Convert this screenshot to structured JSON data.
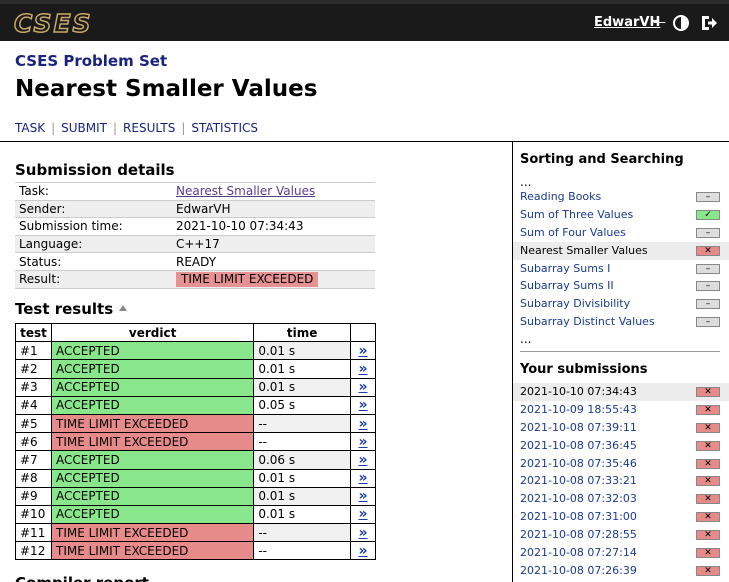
{
  "header": {
    "logo": "CSES",
    "username": "EdwarVH",
    "separator": "—",
    "theme_icon": "half-circle-icon",
    "logout_icon": "logout-icon"
  },
  "problem_set": "CSES Problem Set",
  "title": "Nearest Smaller Values",
  "tabs": [
    {
      "label": "TASK"
    },
    {
      "label": "SUBMIT"
    },
    {
      "label": "RESULTS"
    },
    {
      "label": "STATISTICS"
    }
  ],
  "submission": {
    "heading": "Submission details",
    "rows": [
      {
        "key": "Task:",
        "value": "Nearest Smaller Values"
      },
      {
        "key": "Sender:",
        "value": "EdwarVH"
      },
      {
        "key": "Submission time:",
        "value": "2021-10-10 07:34:43"
      },
      {
        "key": "Language:",
        "value": "C++17"
      },
      {
        "key": "Status:",
        "value": "READY"
      },
      {
        "key": "Result:",
        "value": "TIME LIMIT EXCEEDED"
      }
    ]
  },
  "tests": {
    "heading": "Test results",
    "columns": {
      "test": "test",
      "verdict": "verdict",
      "time": "time"
    },
    "link_glyph": "»",
    "rows": [
      {
        "test": "#1",
        "verdict": "ACCEPTED",
        "time": "0.01 s",
        "status": "ok"
      },
      {
        "test": "#2",
        "verdict": "ACCEPTED",
        "time": "0.01 s",
        "status": "ok"
      },
      {
        "test": "#3",
        "verdict": "ACCEPTED",
        "time": "0.01 s",
        "status": "ok"
      },
      {
        "test": "#4",
        "verdict": "ACCEPTED",
        "time": "0.05 s",
        "status": "ok"
      },
      {
        "test": "#5",
        "verdict": "TIME LIMIT EXCEEDED",
        "time": "--",
        "status": "bad"
      },
      {
        "test": "#6",
        "verdict": "TIME LIMIT EXCEEDED",
        "time": "--",
        "status": "bad"
      },
      {
        "test": "#7",
        "verdict": "ACCEPTED",
        "time": "0.06 s",
        "status": "ok"
      },
      {
        "test": "#8",
        "verdict": "ACCEPTED",
        "time": "0.01 s",
        "status": "ok"
      },
      {
        "test": "#9",
        "verdict": "ACCEPTED",
        "time": "0.01 s",
        "status": "ok"
      },
      {
        "test": "#10",
        "verdict": "ACCEPTED",
        "time": "0.01 s",
        "status": "ok"
      },
      {
        "test": "#11",
        "verdict": "TIME LIMIT EXCEEDED",
        "time": "--",
        "status": "bad"
      },
      {
        "test": "#12",
        "verdict": "TIME LIMIT EXCEEDED",
        "time": "--",
        "status": "bad"
      }
    ]
  },
  "compiler_heading": "Compiler report",
  "sidebar": {
    "section_heading": "Sorting and Searching",
    "ellipsis": "...",
    "problems": [
      {
        "name": "Reading Books",
        "status": "none",
        "current": false
      },
      {
        "name": "Sum of Three Values",
        "status": "ok",
        "current": false
      },
      {
        "name": "Sum of Four Values",
        "status": "none",
        "current": false
      },
      {
        "name": "Nearest Smaller Values",
        "status": "bad",
        "current": true
      },
      {
        "name": "Subarray Sums I",
        "status": "none",
        "current": false
      },
      {
        "name": "Subarray Sums II",
        "status": "none",
        "current": false
      },
      {
        "name": "Subarray Divisibility",
        "status": "none",
        "current": false
      },
      {
        "name": "Subarray Distinct Values",
        "status": "none",
        "current": false
      }
    ],
    "submissions_heading": "Your submissions",
    "submissions": [
      {
        "time": "2021-10-10 07:34:43",
        "current": true
      },
      {
        "time": "2021-10-09 18:55:43",
        "current": false
      },
      {
        "time": "2021-10-08 07:39:11",
        "current": false
      },
      {
        "time": "2021-10-08 07:36:45",
        "current": false
      },
      {
        "time": "2021-10-08 07:35:46",
        "current": false
      },
      {
        "time": "2021-10-08 07:33:21",
        "current": false
      },
      {
        "time": "2021-10-08 07:32:03",
        "current": false
      },
      {
        "time": "2021-10-08 07:31:00",
        "current": false
      },
      {
        "time": "2021-10-08 07:28:55",
        "current": false
      },
      {
        "time": "2021-10-08 07:27:14",
        "current": false
      },
      {
        "time": "2021-10-08 07:26:39",
        "current": false
      }
    ]
  },
  "colors": {
    "accepted": "#8ae68a",
    "rejected": "#e68a8a",
    "logo": "#c8a766",
    "link": "#1a3a8c"
  }
}
